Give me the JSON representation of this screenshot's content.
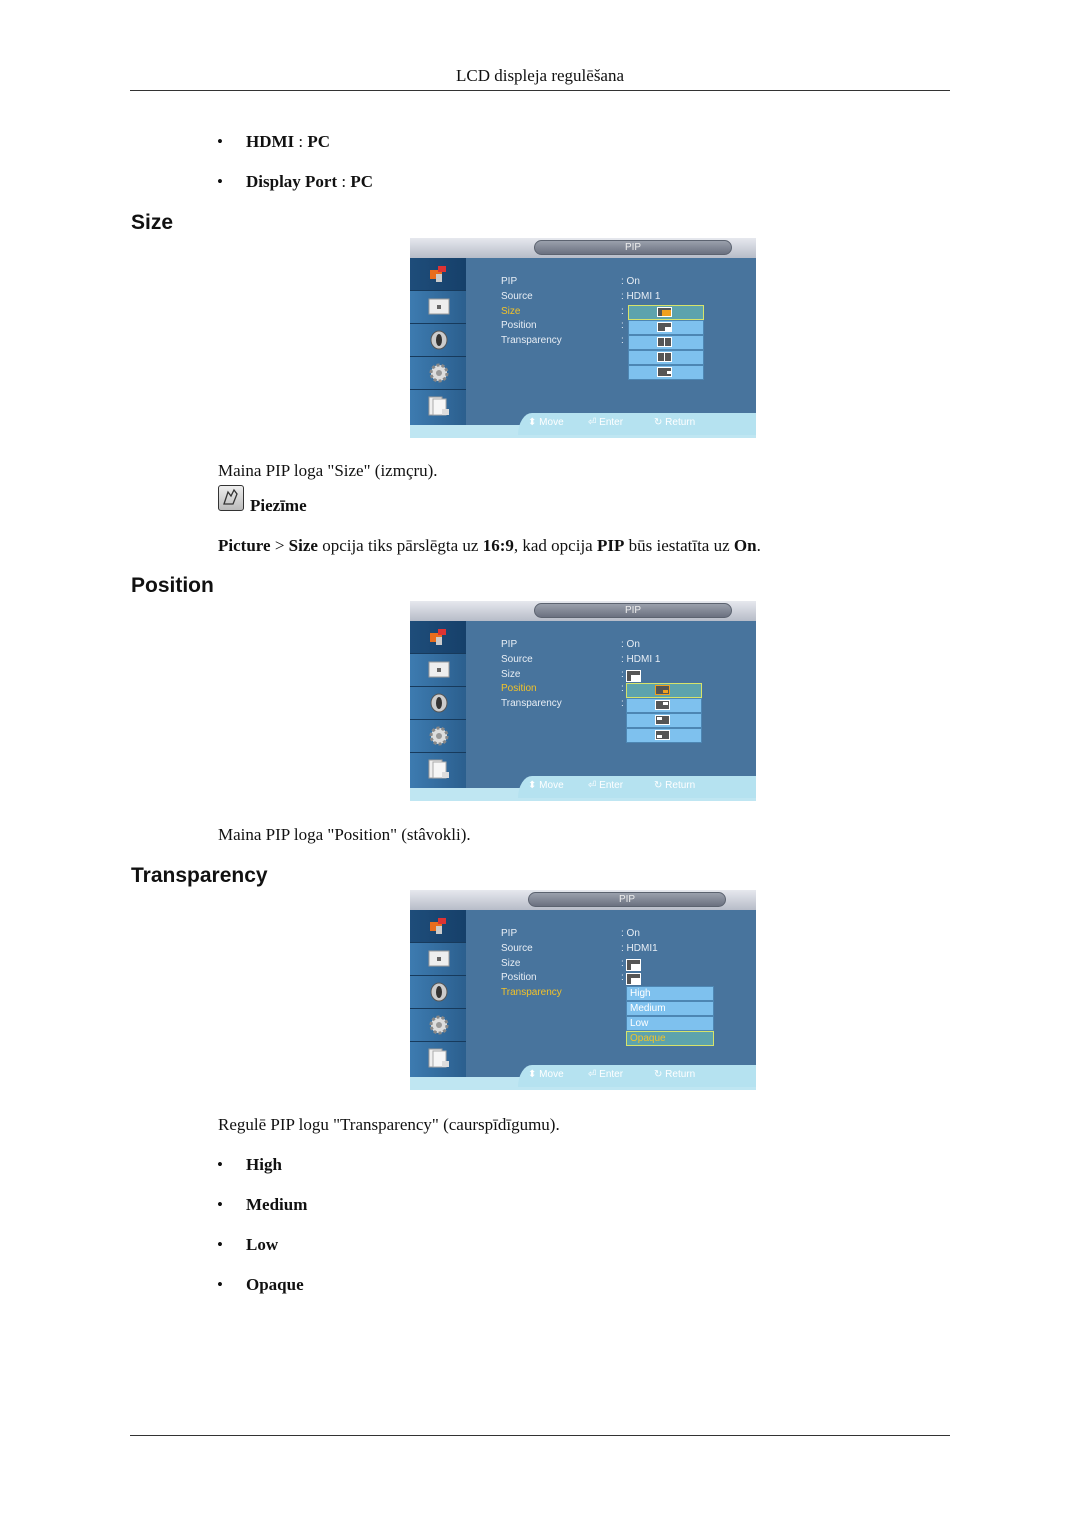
{
  "header": {
    "title": "LCD displeja regulēšana"
  },
  "source_bullets": [
    {
      "left": "HDMI",
      "sep": " : ",
      "right": "PC"
    },
    {
      "left": "Display Port",
      "sep": " : ",
      "right": "PC"
    }
  ],
  "sections": {
    "size": {
      "heading": "Size",
      "description": "Maina PIP loga \"Size\" (izmçru).",
      "note_label": "Piezīme",
      "note": {
        "p1": "Picture",
        "p2": " > ",
        "p3": "Size",
        "p4": " opcija tiks pārslēgta uz ",
        "p5": "16:9",
        "p6": ", kad opcija ",
        "p7": "PIP",
        "p8": " būs iestatīta uz ",
        "p9": "On",
        "p10": "."
      }
    },
    "position": {
      "heading": "Position",
      "description": "Maina PIP loga \"Position\" (stâvokli)."
    },
    "transparency": {
      "heading": "Transparency",
      "description": "Regulē PIP logu \"Transparency\" (caurspīdīgumu).",
      "options": [
        "High",
        "Medium",
        "Low",
        "Opaque"
      ]
    }
  },
  "osd": {
    "title": "PIP",
    "labels": [
      "PIP",
      "Source",
      "Size",
      "Position",
      "Transparency"
    ],
    "footer": {
      "move": "Move",
      "enter": "Enter",
      "return": "Return"
    },
    "screens": [
      {
        "selected": "Size",
        "values": [
          ": On",
          ": HDMI 1",
          ":",
          ":",
          ":"
        ],
        "dropdown_count": 5
      },
      {
        "selected": "Position",
        "values": [
          ": On",
          ": HDMI 1",
          ":",
          ":",
          ":"
        ],
        "dropdown_count": 4
      },
      {
        "selected": "Transparency",
        "values": [
          ": On",
          ": HDMI1",
          ":",
          ":",
          ":"
        ],
        "dropdown": [
          "High",
          "Medium",
          "Low",
          "Opaque"
        ],
        "dropdown_selected": "Opaque"
      }
    ],
    "colors": {
      "selected_text": "#f2c229",
      "panel": "#48749d",
      "dropdown": "#7ec1ee"
    }
  }
}
